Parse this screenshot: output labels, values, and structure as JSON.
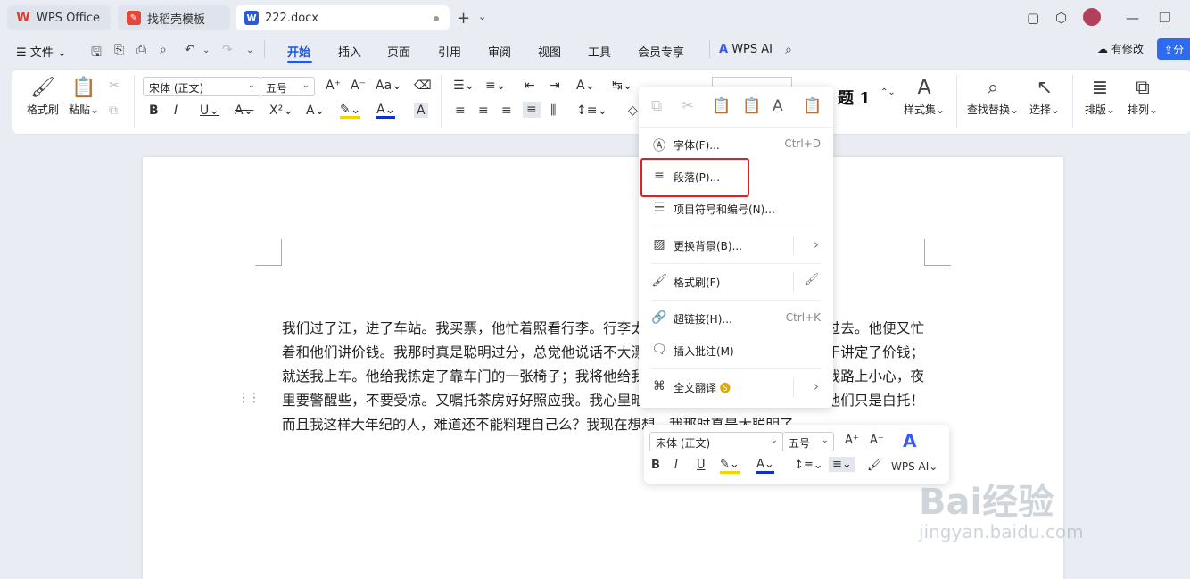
{
  "tabs": [
    {
      "label": "WPS Office",
      "icon": "wps-logo-icon",
      "color": "#e23b2e"
    },
    {
      "label": "找稻壳模板",
      "icon": "docer-icon",
      "color": "#e5483b"
    },
    {
      "label": "222.docx",
      "icon": "word-doc-icon",
      "color": "#2a5bd7",
      "active": true
    }
  ],
  "menu": {
    "file": "文件",
    "items": [
      "开始",
      "插入",
      "页面",
      "引用",
      "审阅",
      "视图",
      "工具",
      "会员专享"
    ],
    "active": "开始",
    "wps_ai": "WPS AI",
    "modified": "有修改",
    "share": "分"
  },
  "ribbon": {
    "format_painter": "格式刷",
    "paste": "粘贴",
    "font_name": "宋体 (正文)",
    "font_size": "五号",
    "style_heading_preview": "题 1",
    "styles": "样式集",
    "find_replace": "查找替换",
    "select": "选择",
    "layout": "排版",
    "arrange": "排列"
  },
  "document": {
    "text": "我们过了江，进了车站。我买票，他忙着照看行李。行李太多了，得向脚夫行些小费才可过去。他便又忙着和他们讲价钱。我那时真是聪明过分，总觉他说话不大漂亮，非自己插嘴不可，但他终于讲定了价钱；就送我上车。他给我拣定了靠车门的一张椅子；我将他给我做的紫毛大衣铺好座位。他嘱我路上小心，夜里要警醒些，不要受凉。又嘱托茶房好好照应我。我心里暗笑他的迂；他们只认得钱，托他们只是白托！而且我这样大年纪的人，难道还不能料理自己么？我现在想想，我那时真是太聪明了。"
  },
  "context_menu": {
    "items": [
      {
        "label": "字体(F)...",
        "shortcut": "Ctrl+D",
        "icon": "font-icon"
      },
      {
        "label": "段落(P)...",
        "icon": "paragraph-icon",
        "highlighted": true
      },
      {
        "label": "项目符号和编号(N)...",
        "icon": "bullet-list-icon"
      },
      {
        "label": "更换背景(B)...",
        "icon": "background-icon",
        "submenu": true
      },
      {
        "label": "格式刷(F)",
        "icon": "format-painter-icon"
      },
      {
        "label": "超链接(H)...",
        "shortcut": "Ctrl+K",
        "icon": "hyperlink-icon"
      },
      {
        "label": "插入批注(M)",
        "icon": "comment-icon"
      },
      {
        "label": "全文翻译",
        "icon": "translate-icon",
        "submenu": true
      }
    ],
    "highlight_color": "#e02020"
  },
  "mini_toolbar": {
    "font_name": "宋体 (正文)",
    "font_size": "五号",
    "wps_ai": "WPS AI"
  },
  "watermark": {
    "brand": "Bai经验",
    "url": "jingyan.baidu.com"
  },
  "colors": {
    "accent": "#1a58e8",
    "highlight_yellow": "#f5d300",
    "font_color_blue": "#1030c8"
  }
}
